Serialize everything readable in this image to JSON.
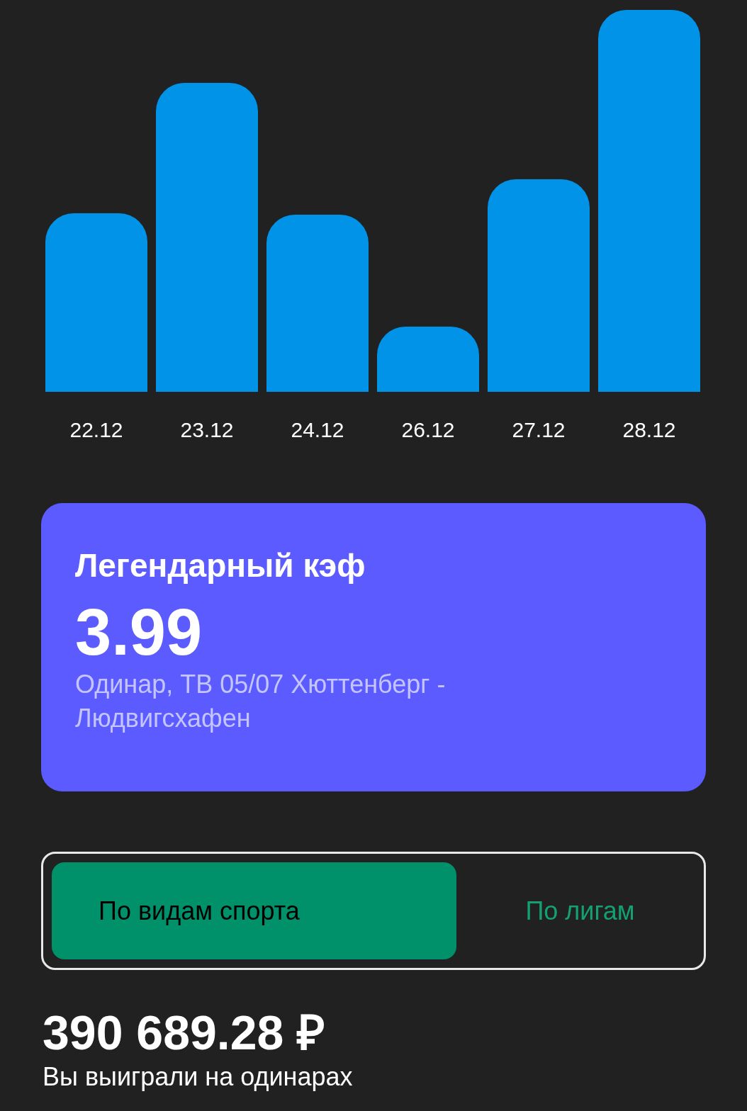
{
  "chart": {
    "bars": [
      {
        "label": "22.12"
      },
      {
        "label": "23.12"
      },
      {
        "label": "24.12"
      },
      {
        "label": "26.12"
      },
      {
        "label": "27.12"
      },
      {
        "label": "28.12"
      }
    ]
  },
  "record_card": {
    "title": "Легендарный кэф",
    "value": "3.99",
    "description": "Одинар, ТВ 05/07 Хюттенберг - Людвигсхафен"
  },
  "segments": [
    {
      "label": "По видам спорта",
      "selected": true
    },
    {
      "label": "По лигам",
      "selected": false
    }
  ],
  "winnings": {
    "amount": "390 689.28 ₽",
    "caption": "Вы выиграли на одинарах"
  }
}
